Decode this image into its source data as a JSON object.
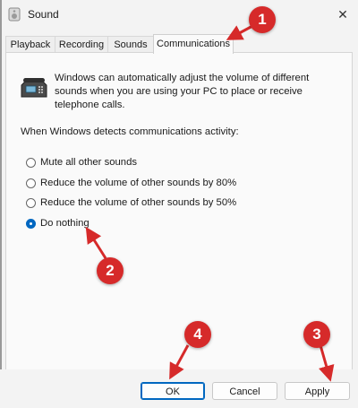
{
  "window": {
    "title": "Sound",
    "app_icon": "speaker-icon",
    "close_icon": "close-icon",
    "close_glyph": "✕"
  },
  "tabs": [
    {
      "label": "Playback",
      "active": false
    },
    {
      "label": "Recording",
      "active": false
    },
    {
      "label": "Sounds",
      "active": false
    },
    {
      "label": "Communications",
      "active": true
    }
  ],
  "panel": {
    "description": "Windows can automatically adjust the volume of different sounds when you are using your PC to place or receive telephone calls.",
    "section_label": "When Windows detects communications activity:",
    "phone_icon": "telephone-icon",
    "options": [
      {
        "label": "Mute all other sounds",
        "checked": false
      },
      {
        "label": "Reduce the volume of other sounds by 80%",
        "checked": false
      },
      {
        "label": "Reduce the volume of other sounds by 50%",
        "checked": false
      },
      {
        "label": "Do nothing",
        "checked": true
      }
    ]
  },
  "buttons": {
    "ok": "OK",
    "cancel": "Cancel",
    "apply": "Apply"
  },
  "annotations": [
    {
      "number": "1",
      "target": "Communications tab"
    },
    {
      "number": "2",
      "target": "Do nothing option"
    },
    {
      "number": "3",
      "target": "Apply button"
    },
    {
      "number": "4",
      "target": "OK button"
    }
  ],
  "colors": {
    "accent": "#0067c0",
    "annotation": "#d62a2a"
  }
}
